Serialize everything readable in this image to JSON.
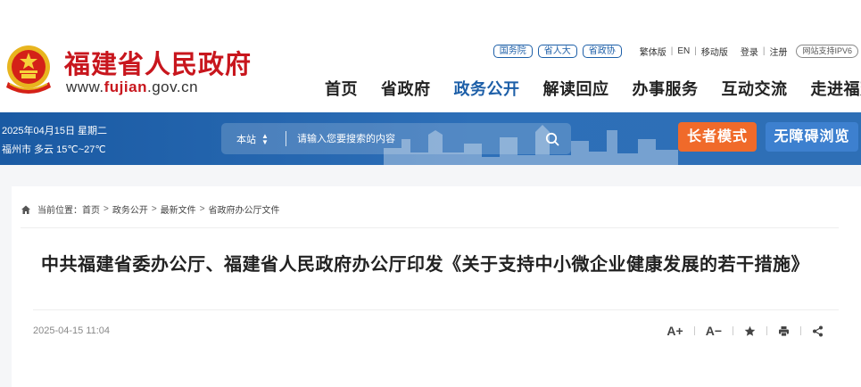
{
  "header": {
    "site_name": "福建省人民政府",
    "url_prefix": "www.",
    "url_domain": "fujian",
    "url_suffix": ".gov.cn",
    "emblem_icon": "national-emblem-icon",
    "org_tags": [
      "国务院",
      "省人大",
      "省政协"
    ],
    "lang_links": [
      "繁体版",
      "EN",
      "移动版"
    ],
    "login_links": [
      "登录",
      "注册"
    ],
    "ipv6_label": "网站支持IPV6",
    "nav": [
      "首页",
      "省政府",
      "政务公开",
      "解读回应",
      "办事服务",
      "互动交流",
      "走进福建"
    ],
    "nav_active": "政务公开"
  },
  "banner": {
    "date_text": "2025年04月15日 星期二",
    "weather_text": "福州市 多云 15℃~27℃",
    "search_scope": "本站",
    "search_placeholder": "请输入您要搜索的内容",
    "elder_mode_label": "长者模式",
    "accessible_label": "无障碍浏览",
    "colors": {
      "banner_blue": "#1d5fa8",
      "elder_orange": "#f06a2a",
      "access_blue": "#3d80cf"
    }
  },
  "article": {
    "breadcrumb_label": "当前位置：",
    "breadcrumb": [
      "首页",
      "政务公开",
      "最新文件",
      "省政府办公厅文件"
    ],
    "title": "中共福建省委办公厅、福建省人民政府办公厅印发《关于支持中小微企业健康发展的若干措施》",
    "publish_time": "2025-04-15 11:04",
    "tools": {
      "font_increase": "A+",
      "font_decrease": "A−",
      "favorite_icon": "star-icon",
      "print_icon": "printer-icon",
      "share_icon": "share-icon"
    }
  }
}
